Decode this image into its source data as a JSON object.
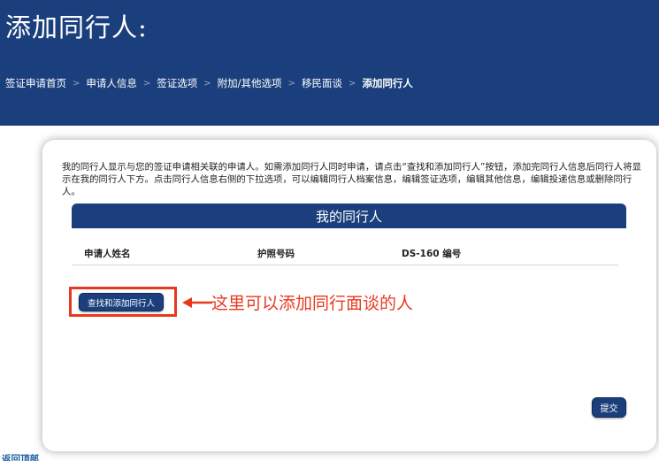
{
  "header": {
    "title": "添加同行人:",
    "breadcrumb": [
      "签证申请首页",
      "申请人信息",
      "签证选项",
      "附加/其他选项",
      "移民面谈",
      "添加同行人"
    ],
    "separator": ">"
  },
  "card": {
    "intro": "我的同行人显示与您的签证申请相关联的申请人。如需添加同行人同时申请，请点击“查找和添加同行人”按钮，添加完同行人信息后同行人将显示在我的同行人下方。点击同行人信息右侧的下拉选项，可以编辑同行人档案信息，编辑签证选项，编辑其他信息，编辑投递信息或删除同行人。",
    "section_title": "我的同行人",
    "columns": [
      "申请人姓名",
      "护照号码",
      "DS-160 编号"
    ],
    "find_add_button": "查找和添加同行人",
    "annotation": "这里可以添加同行面谈的人",
    "submit_button": "提交"
  },
  "footer": {
    "back_to_top": "返回顶部"
  },
  "colors": {
    "brand_navy": "#1b3f7c",
    "annotation_red": "#e8391f",
    "link_blue": "#1b5aa6"
  }
}
